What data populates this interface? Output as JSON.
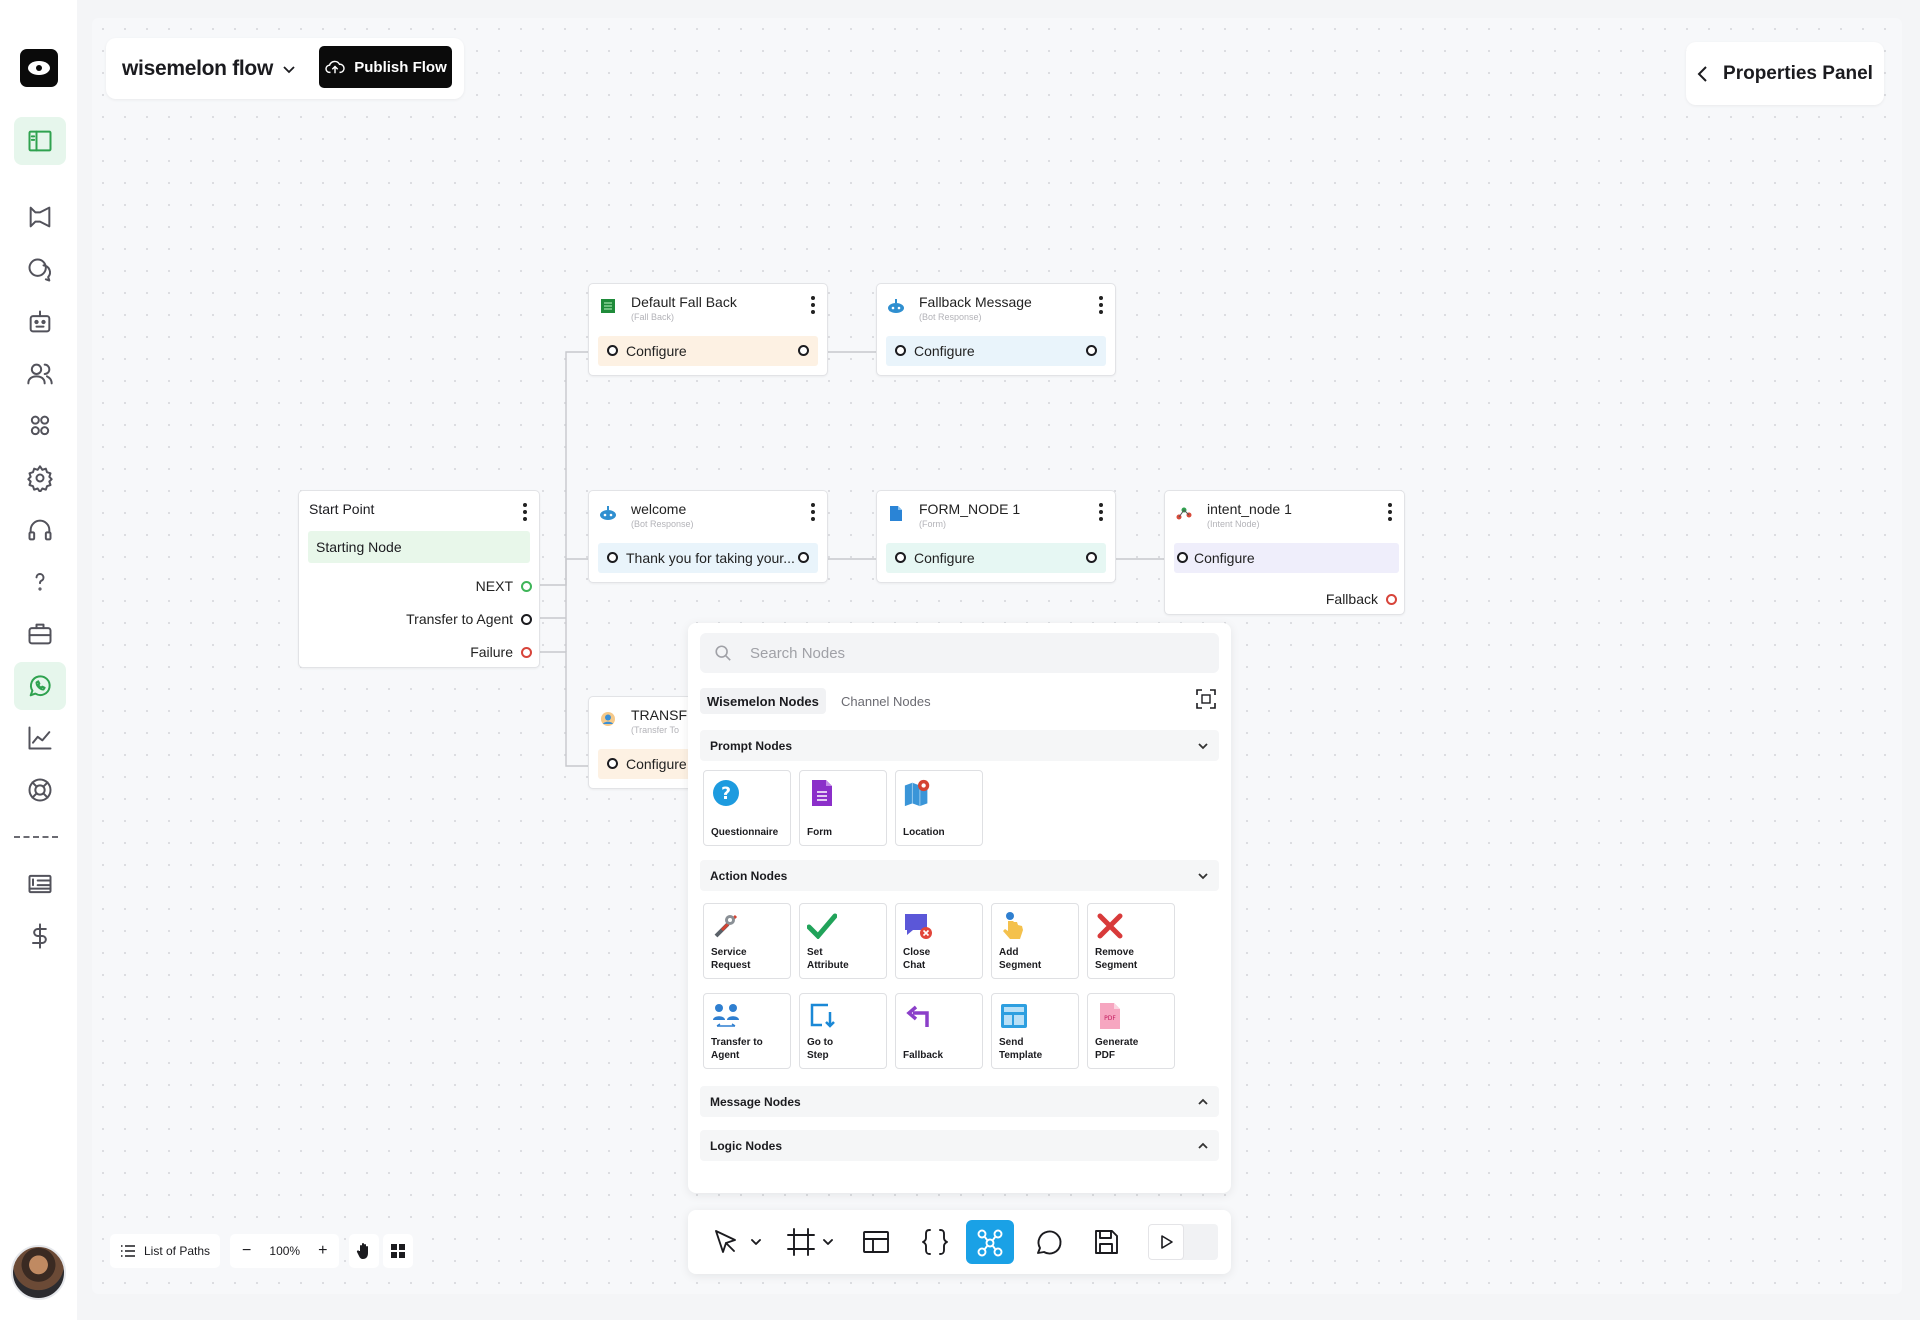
{
  "flow": {
    "name": "wisemelon flow",
    "publish_label": "Publish Flow"
  },
  "properties_label": "Properties Panel",
  "nodes": {
    "start": {
      "title": "Start Point",
      "body": "Starting Node",
      "outputs": [
        "NEXT",
        "Transfer to Agent",
        "Failure"
      ]
    },
    "default_fallback": {
      "title": "Default Fall Back",
      "sub": "(Fall Back)",
      "cfg": "Configure"
    },
    "fallback_message": {
      "title": "Fallback Message",
      "sub": "(Bot Response)",
      "cfg": "Configure"
    },
    "welcome": {
      "title": "welcome",
      "sub": "(Bot Response)",
      "cfg": "Thank you for taking your..."
    },
    "form_node": {
      "title": "FORM_NODE 1",
      "sub": "(Form)",
      "cfg": "Configure"
    },
    "intent_node": {
      "title": "intent_node 1",
      "sub": "(Intent Node)",
      "cfg": "Configure",
      "output": "Fallback"
    },
    "transfer": {
      "title": "TRANSFEI",
      "sub": "(Transfer To",
      "cfg": "Configure"
    }
  },
  "palette": {
    "search_placeholder": "Search Nodes",
    "tabs": [
      "Wisemelon Nodes",
      "Channel Nodes"
    ],
    "sections": {
      "prompt": "Prompt Nodes",
      "action": "Action Nodes",
      "message": "Message Nodes",
      "logic": "Logic Nodes"
    },
    "prompt_tiles": [
      "Questionnaire",
      "Form",
      "Location"
    ],
    "action_tiles": [
      "Service\nRequest",
      "Set\nAttribute",
      "Close\nChat",
      "Add\nSegment",
      "Remove\nSegment",
      "Transfer to\nAgent",
      "Go to\nStep",
      "Fallback",
      "Send\nTemplate",
      "Generate\nPDF"
    ]
  },
  "bottom": {
    "paths_label": "List of Paths",
    "zoom": "100%"
  },
  "colors": {
    "accent": "#1aa1e6",
    "brand_green": "#2fa24f",
    "fallback_bg": "#fdf1e3",
    "bot_bg": "#e9f4fb",
    "form_bg": "#e6f7f3",
    "intent_bg": "#efeefb",
    "start_bg": "#e8f7ea"
  }
}
